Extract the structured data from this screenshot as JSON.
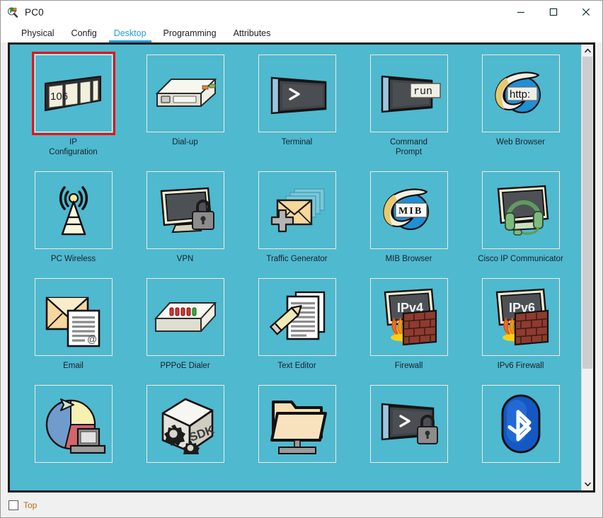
{
  "window": {
    "title": "PC0",
    "app_icon": "packet-tracer-icon",
    "controls": {
      "minimize": "minimize-icon",
      "maximize": "maximize-icon",
      "close": "close-icon"
    }
  },
  "tabs": [
    {
      "label": "Physical",
      "active": false
    },
    {
      "label": "Config",
      "active": false
    },
    {
      "label": "Desktop",
      "active": true
    },
    {
      "label": "Programming",
      "active": false
    },
    {
      "label": "Attributes",
      "active": false
    }
  ],
  "desktop": {
    "background_color": "#4fb9cf",
    "selection_color": "#ee1111",
    "items": [
      {
        "label": "IP\nConfiguration",
        "icon": "ip-configuration-icon",
        "selected": true
      },
      {
        "label": "Dial-up",
        "icon": "dial-up-icon",
        "selected": false
      },
      {
        "label": "Terminal",
        "icon": "terminal-icon",
        "selected": false
      },
      {
        "label": "Command\nPrompt",
        "icon": "command-prompt-icon",
        "selected": false
      },
      {
        "label": "Web Browser",
        "icon": "web-browser-icon",
        "selected": false
      },
      {
        "label": "PC Wireless",
        "icon": "pc-wireless-icon",
        "selected": false
      },
      {
        "label": "VPN",
        "icon": "vpn-icon",
        "selected": false
      },
      {
        "label": "Traffic Generator",
        "icon": "traffic-generator-icon",
        "selected": false
      },
      {
        "label": "MIB Browser",
        "icon": "mib-browser-icon",
        "selected": false
      },
      {
        "label": "Cisco IP Communicator",
        "icon": "cisco-ip-communicator-icon",
        "selected": false
      },
      {
        "label": "Email",
        "icon": "email-icon",
        "selected": false
      },
      {
        "label": "PPPoE Dialer",
        "icon": "pppoe-dialer-icon",
        "selected": false
      },
      {
        "label": "Text Editor",
        "icon": "text-editor-icon",
        "selected": false
      },
      {
        "label": "Firewall",
        "icon": "firewall-icon",
        "selected": false
      },
      {
        "label": "IPv6 Firewall",
        "icon": "ipv6-firewall-icon",
        "selected": false
      },
      {
        "label": "",
        "icon": "traffic-analysis-icon",
        "selected": false
      },
      {
        "label": "",
        "icon": "sdk-icon",
        "selected": false
      },
      {
        "label": "",
        "icon": "file-manager-icon",
        "selected": false
      },
      {
        "label": "",
        "icon": "secure-terminal-icon",
        "selected": false
      },
      {
        "label": "",
        "icon": "bluetooth-icon",
        "selected": false
      }
    ],
    "icon_text": {
      "ip_config_number": "106",
      "terminal_prompt": ">",
      "command_prompt_run": "run",
      "web_browser_http": "http:",
      "mib_label": "MIB",
      "firewall_v4": "IPv4",
      "firewall_v6": "IPv6",
      "sdk_label": "SDK",
      "email_at": "@"
    }
  },
  "scrollbar": {
    "up_arrow": "chevron-up-icon",
    "down_arrow": "chevron-down-icon",
    "thumb_position_percent": 0,
    "thumb_size_percent": 74
  },
  "statusbar": {
    "top_checkbox_label": "Top",
    "top_checkbox_checked": false,
    "label_color": "#b4701c"
  }
}
